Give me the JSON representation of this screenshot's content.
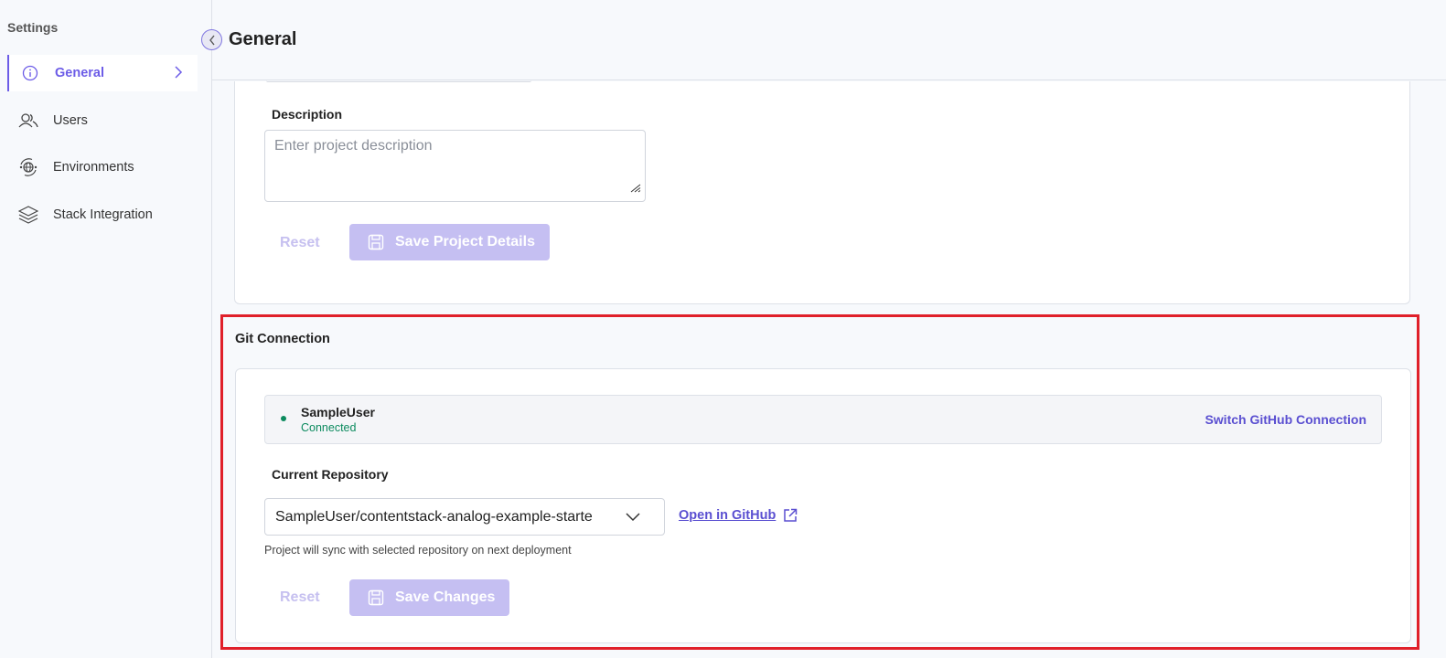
{
  "sidebar": {
    "title": "Settings",
    "items": [
      {
        "label": "General",
        "icon": "info-icon",
        "active": true
      },
      {
        "label": "Users",
        "icon": "users-icon",
        "active": false
      },
      {
        "label": "Environments",
        "icon": "environments-icon",
        "active": false
      },
      {
        "label": "Stack Integration",
        "icon": "layers-icon",
        "active": false
      }
    ]
  },
  "header": {
    "title": "General"
  },
  "project": {
    "description_label": "Description",
    "description_placeholder": "Enter project description",
    "reset_label": "Reset",
    "save_label": "Save Project Details"
  },
  "git": {
    "section_title": "Git Connection",
    "user": "SampleUser",
    "status": "Connected",
    "switch_label": "Switch GitHub Connection",
    "repo_label": "Current Repository",
    "repo_value": "SampleUser/contentstack-analog-example-starte",
    "open_label": "Open in GitHub",
    "hint": "Project will sync with selected repository on next deployment",
    "reset_label": "Reset",
    "save_label": "Save Changes"
  },
  "colors": {
    "accent": "#6c5ce7",
    "disabled_button": "#c5bff2",
    "connected": "#0b8a5e",
    "highlight_border": "#e0202a"
  }
}
